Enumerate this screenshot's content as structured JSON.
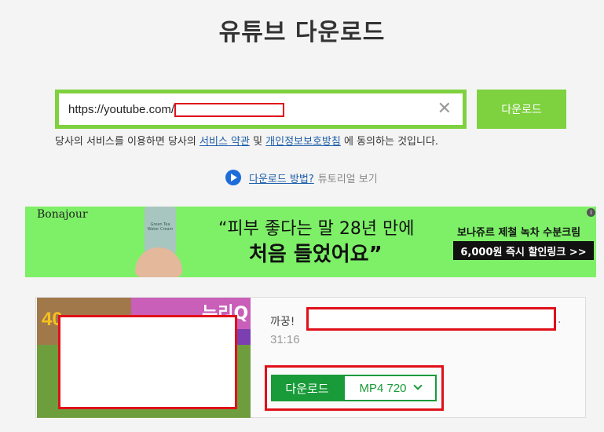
{
  "page_title": "유튜브 다운로드",
  "search": {
    "value": "https://youtube.com/",
    "placeholder": "",
    "clear_icon": "close-icon"
  },
  "download_button_label": "다운로드",
  "terms": {
    "prefix": "당사의 서비스를 이용하면 당사의",
    "link1": "서비스 약관",
    "mid": "및",
    "link2": "개인정보보호방침",
    "suffix": "에 동의하는 것입니다."
  },
  "howto": {
    "icon": "play-icon",
    "link": "다운로드 방법?",
    "sub": "튜토리얼 보기"
  },
  "ad": {
    "brand": "Bonajour",
    "tube_label": "Green Tea Water Cream",
    "line1": "“피부 좋다는 말 28년 만에",
    "line2": "처음 들었어요”",
    "right_title": "보나쥬르 제철 녹차 수분크림",
    "cta": "6,000원 즉시 할인링크 >>",
    "info_icon": "info-icon"
  },
  "result": {
    "thumbnail_badge": "40",
    "thumbnail_brand": "누리Q",
    "title_prefix": "까꿍!",
    "title_suffix": ".",
    "duration": "31:16",
    "download_label": "다운로드",
    "format": "MP4  720"
  },
  "colors": {
    "accent_green": "#7ed13f",
    "download_green": "#199b3a",
    "link_blue": "#1c5da8",
    "redaction_red": "#e0101a"
  }
}
